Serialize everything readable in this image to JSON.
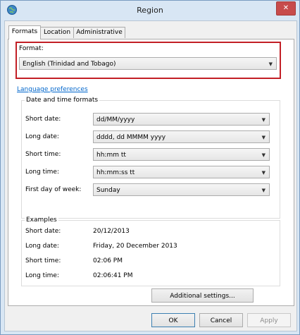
{
  "window": {
    "title": "Region",
    "close_symbol": "✕"
  },
  "tabs": [
    {
      "label": "Formats",
      "active": true
    },
    {
      "label": "Location",
      "active": false
    },
    {
      "label": "Administrative",
      "active": false
    }
  ],
  "format": {
    "label": "Format:",
    "selected": "English (Trinidad and Tobago)"
  },
  "language_preferences_link": "Language preferences",
  "date_time_formats": {
    "title": "Date and time formats",
    "rows": [
      {
        "label": "Short date:",
        "value": "dd/MM/yyyy"
      },
      {
        "label": "Long date:",
        "value": "dddd, dd MMMM yyyy"
      },
      {
        "label": "Short time:",
        "value": "hh:mm tt"
      },
      {
        "label": "Long time:",
        "value": "hh:mm:ss tt"
      },
      {
        "label": "First day of week:",
        "value": "Sunday"
      }
    ]
  },
  "examples": {
    "title": "Examples",
    "rows": [
      {
        "label": "Short date:",
        "value": "20/12/2013"
      },
      {
        "label": "Long date:",
        "value": "Friday, 20 December 2013"
      },
      {
        "label": "Short time:",
        "value": "02:06 PM"
      },
      {
        "label": "Long time:",
        "value": "02:06:41 PM"
      }
    ]
  },
  "buttons": {
    "additional_settings": "Additional settings...",
    "ok": "OK",
    "cancel": "Cancel",
    "apply": "Apply"
  },
  "icons": {
    "dropdown_arrow": "▼"
  },
  "colors": {
    "highlight_border": "#c21f26",
    "link": "#0066cc",
    "close_button": "#c74b4b"
  }
}
